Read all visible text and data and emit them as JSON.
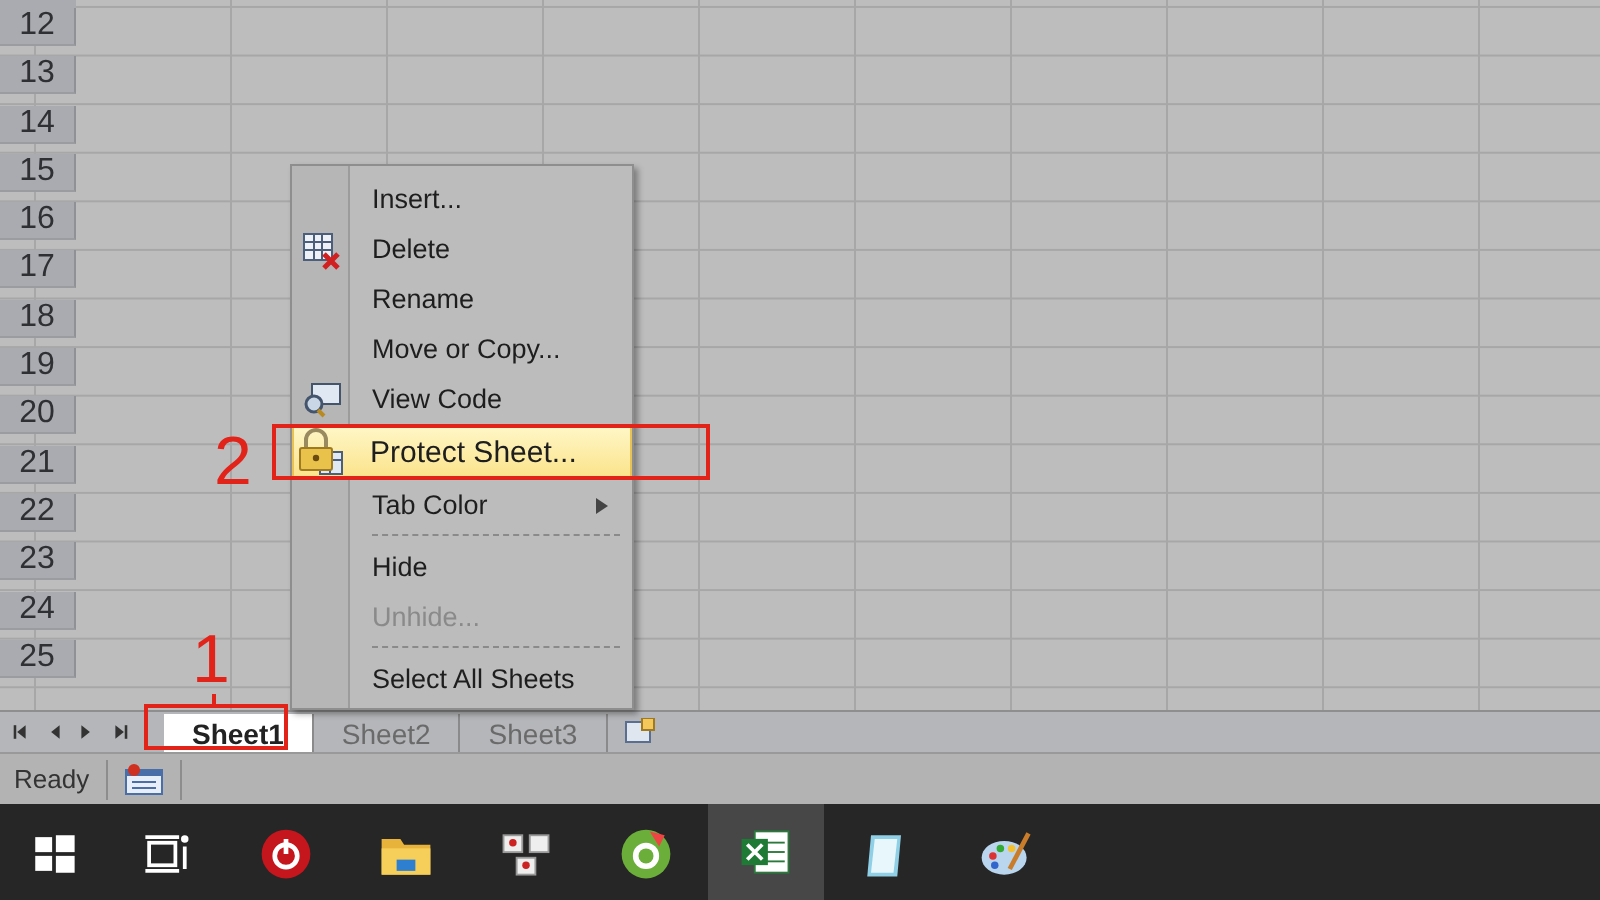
{
  "sheet": {
    "row_numbers": [
      "12",
      "13",
      "14",
      "15",
      "16",
      "17",
      "18",
      "19",
      "20",
      "21",
      "22",
      "23",
      "24",
      "25"
    ]
  },
  "context_menu": {
    "groups": [
      [
        {
          "label": "Insert...",
          "kind": "plain",
          "selected": false,
          "disabled": false
        },
        {
          "label": "Delete",
          "kind": "delete",
          "selected": false,
          "disabled": false
        },
        {
          "label": "Rename",
          "kind": "plain",
          "selected": false,
          "disabled": false
        },
        {
          "label": "Move or Copy...",
          "kind": "plain",
          "selected": false,
          "disabled": false
        },
        {
          "label": "View Code",
          "kind": "view-code",
          "selected": false,
          "disabled": false
        },
        {
          "label": "Protect Sheet...",
          "kind": "protect",
          "selected": true,
          "disabled": false
        },
        {
          "label": "Tab Color",
          "kind": "submenu",
          "selected": false,
          "disabled": false
        }
      ],
      [
        {
          "label": "Hide",
          "kind": "plain",
          "selected": false,
          "disabled": false
        },
        {
          "label": "Unhide...",
          "kind": "plain",
          "selected": false,
          "disabled": true
        }
      ],
      [
        {
          "label": "Select All Sheets",
          "kind": "plain",
          "selected": false,
          "disabled": false
        }
      ]
    ]
  },
  "sheet_tabs": [
    {
      "label": "Sheet1",
      "selected": true
    },
    {
      "label": "Sheet2",
      "selected": false
    },
    {
      "label": "Sheet3",
      "selected": false
    }
  ],
  "status_bar": {
    "text": "Ready"
  },
  "annotations": [
    {
      "label": "1",
      "kind": "tab-marker"
    },
    {
      "label": "2",
      "kind": "menu-marker"
    }
  ],
  "taskbar": [
    {
      "kind": "windows",
      "selected": false
    },
    {
      "kind": "taskview",
      "selected": false
    },
    {
      "kind": "power",
      "selected": false
    },
    {
      "kind": "folder",
      "selected": false
    },
    {
      "kind": "keys",
      "selected": false
    },
    {
      "kind": "ring",
      "selected": false
    },
    {
      "kind": "excel",
      "selected": true
    },
    {
      "kind": "notepad",
      "selected": false
    },
    {
      "kind": "palette",
      "selected": false
    }
  ]
}
